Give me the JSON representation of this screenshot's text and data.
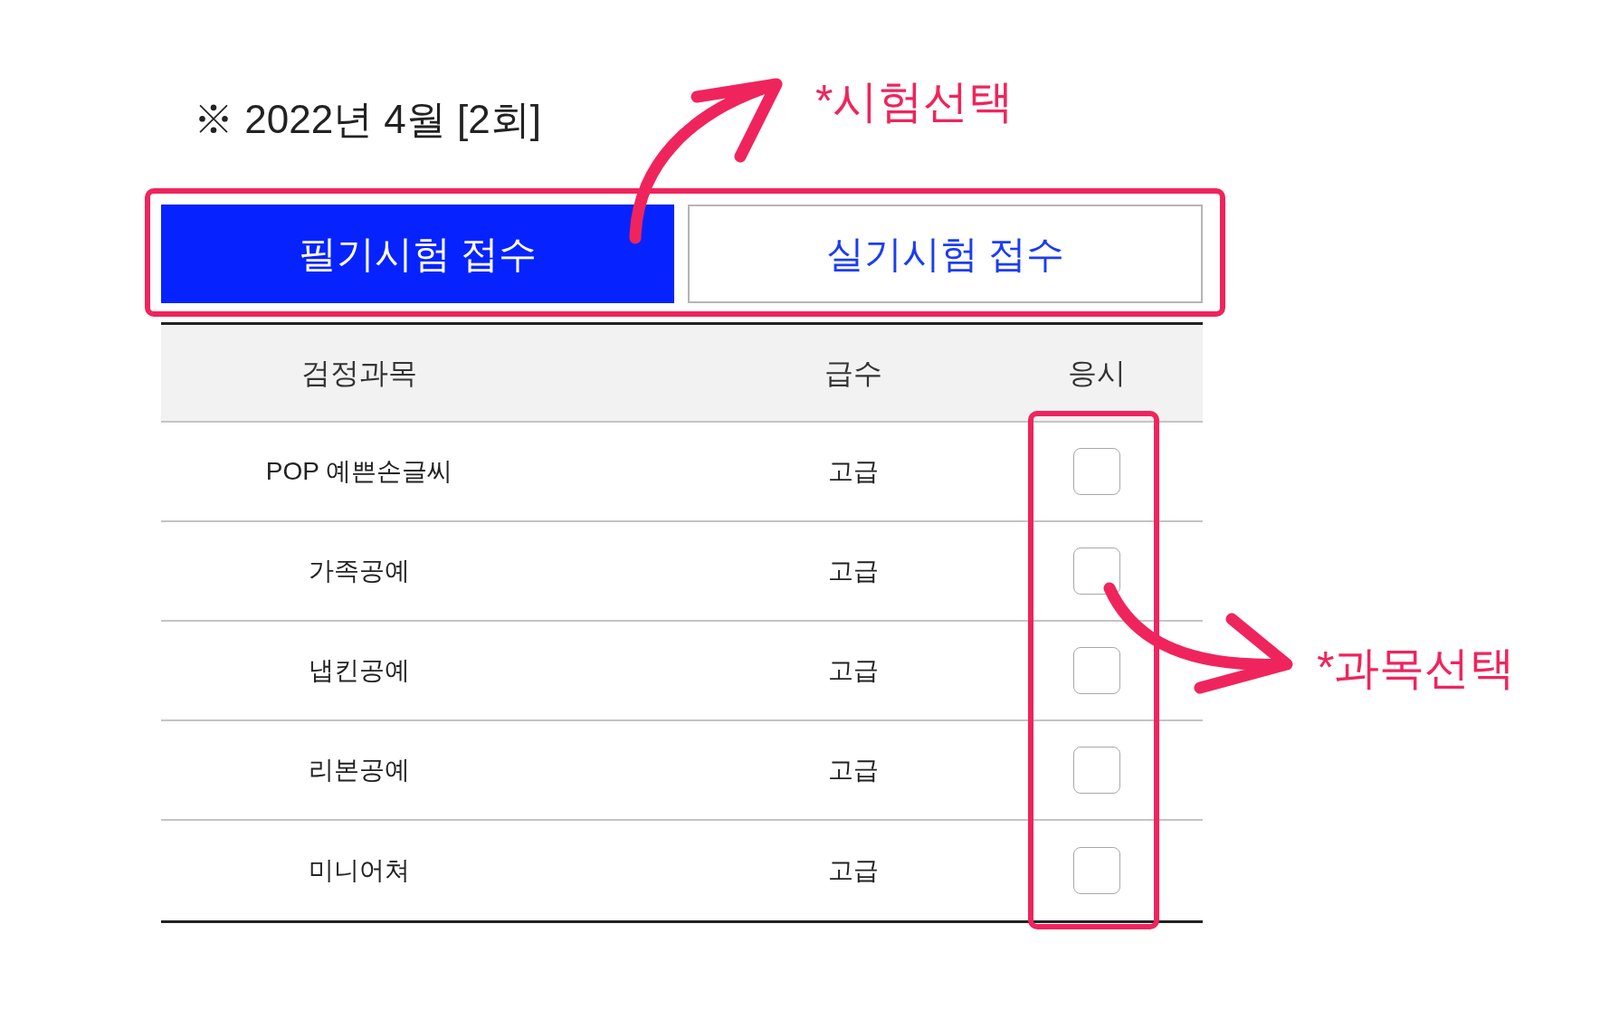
{
  "heading": "※ 2022년 4월 [2회]",
  "tabs": [
    {
      "label": "필기시험 접수",
      "selected": true
    },
    {
      "label": "실기시험 접수",
      "selected": false
    }
  ],
  "table": {
    "columns": [
      "검정과목",
      "급수",
      "응시"
    ],
    "rows": [
      {
        "subject": "POP 예쁜손글씨",
        "grade": "고급",
        "checked": false
      },
      {
        "subject": "가족공예",
        "grade": "고급",
        "checked": false
      },
      {
        "subject": "냅킨공예",
        "grade": "고급",
        "checked": false
      },
      {
        "subject": "리본공예",
        "grade": "고급",
        "checked": false
      },
      {
        "subject": "미니어쳐",
        "grade": "고급",
        "checked": false
      }
    ]
  },
  "annotations": {
    "tabs_note": "*시험선택",
    "checkbox_note": "*과목선택"
  }
}
